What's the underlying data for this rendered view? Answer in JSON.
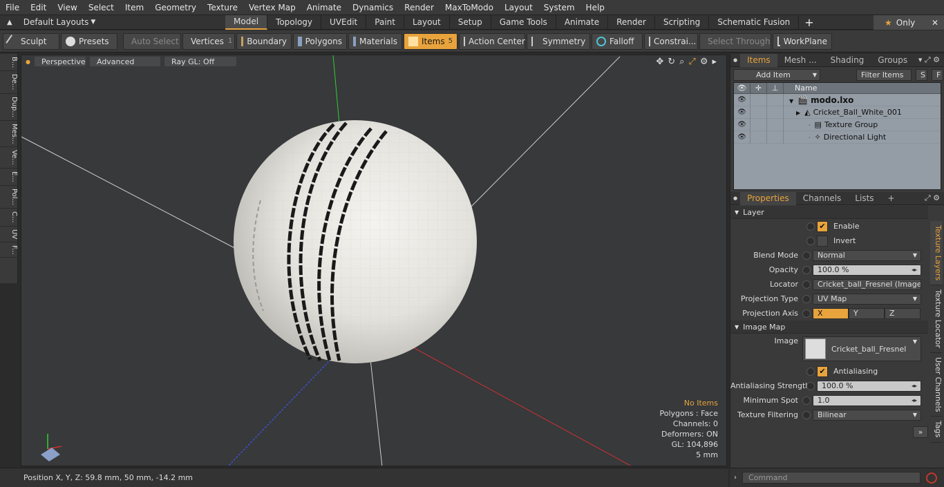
{
  "menu": [
    "File",
    "Edit",
    "View",
    "Select",
    "Item",
    "Geometry",
    "Texture",
    "Vertex Map",
    "Animate",
    "Dynamics",
    "Render",
    "MaxToModo",
    "Layout",
    "System",
    "Help"
  ],
  "layouts_label": "Default Layouts",
  "tabs": [
    {
      "label": "Model",
      "active": true
    },
    {
      "label": "Topology"
    },
    {
      "label": "UVEdit"
    },
    {
      "label": "Paint"
    },
    {
      "label": "Layout"
    },
    {
      "label": "Setup"
    },
    {
      "label": "Game Tools"
    },
    {
      "label": "Animate"
    },
    {
      "label": "Render"
    },
    {
      "label": "Scripting"
    },
    {
      "label": "Schematic Fusion"
    }
  ],
  "only_label": "Only",
  "toolbar": {
    "sculpt": "Sculpt",
    "presets": "Presets",
    "auto_select": "Auto Select",
    "vertices": "Vertices",
    "vertices_count": "1",
    "boundary": "Boundary",
    "polygons": "Polygons",
    "materials": "Materials",
    "items": "Items",
    "items_count": "5",
    "action_center": "Action Center",
    "symmetry": "Symmetry",
    "falloff": "Falloff",
    "constrain": "Constrai...",
    "select_through": "Select Through",
    "workplane": "WorkPlane"
  },
  "left_tabs": [
    "B...",
    "De...",
    "Dup...",
    "Mes...",
    "Ve...",
    "E...",
    "Pol...",
    "C...",
    "UV",
    "F..."
  ],
  "viewport": {
    "perspective": "Perspective",
    "advanced": "Advanced",
    "raygl": "Ray GL: Off",
    "info": {
      "no_items": "No Items",
      "polygons": "Polygons : Face",
      "channels": "Channels: 0",
      "deformers": "Deformers: ON",
      "gl": "GL: 104,896",
      "unit": "5 mm"
    }
  },
  "status": {
    "position": "Position X, Y, Z:   59.8 mm, 50 mm, -14.2 mm"
  },
  "items_panel": {
    "tabs": [
      "Items",
      "Mesh ...",
      "Shading",
      "Groups"
    ],
    "add_item": "Add Item",
    "filter_items": "Filter Items",
    "s": "S",
    "f": "F",
    "name_header": "Name",
    "rows": [
      {
        "name": "modo.lxo"
      },
      {
        "name": "Cricket_Ball_White_001"
      },
      {
        "name": "Texture Group"
      },
      {
        "name": "Directional Light"
      }
    ]
  },
  "properties": {
    "tabs": [
      "Properties",
      "Channels",
      "Lists"
    ],
    "layer_section": "Layer",
    "enable": "Enable",
    "invert": "Invert",
    "blend_mode_label": "Blend Mode",
    "blend_mode": "Normal",
    "opacity_label": "Opacity",
    "opacity": "100.0 %",
    "locator_label": "Locator",
    "locator": "Cricket_ball_Fresnel (Image) ...",
    "projection_type_label": "Projection Type",
    "projection_type": "UV Map",
    "projection_axis_label": "Projection Axis",
    "axis_x": "X",
    "axis_y": "Y",
    "axis_z": "Z",
    "image_map_section": "Image Map",
    "image_label": "Image",
    "image": "Cricket_ball_Fresnel",
    "antialiasing": "Antialiasing",
    "aa_strength_label": "Antialiasing Strength",
    "aa_strength": "100.0 %",
    "min_spot_label": "Minimum Spot",
    "min_spot": "1.0",
    "tex_filter_label": "Texture Filtering",
    "tex_filter": "Bilinear",
    "side_tabs": [
      "Texture Layers",
      "Texture Locator",
      "User Channels",
      "Tags"
    ]
  },
  "command_placeholder": "Command",
  "colors": {
    "accent": "#e8a33c",
    "viewport_bg": "#37393b",
    "tree_bg": "#949ca5"
  }
}
